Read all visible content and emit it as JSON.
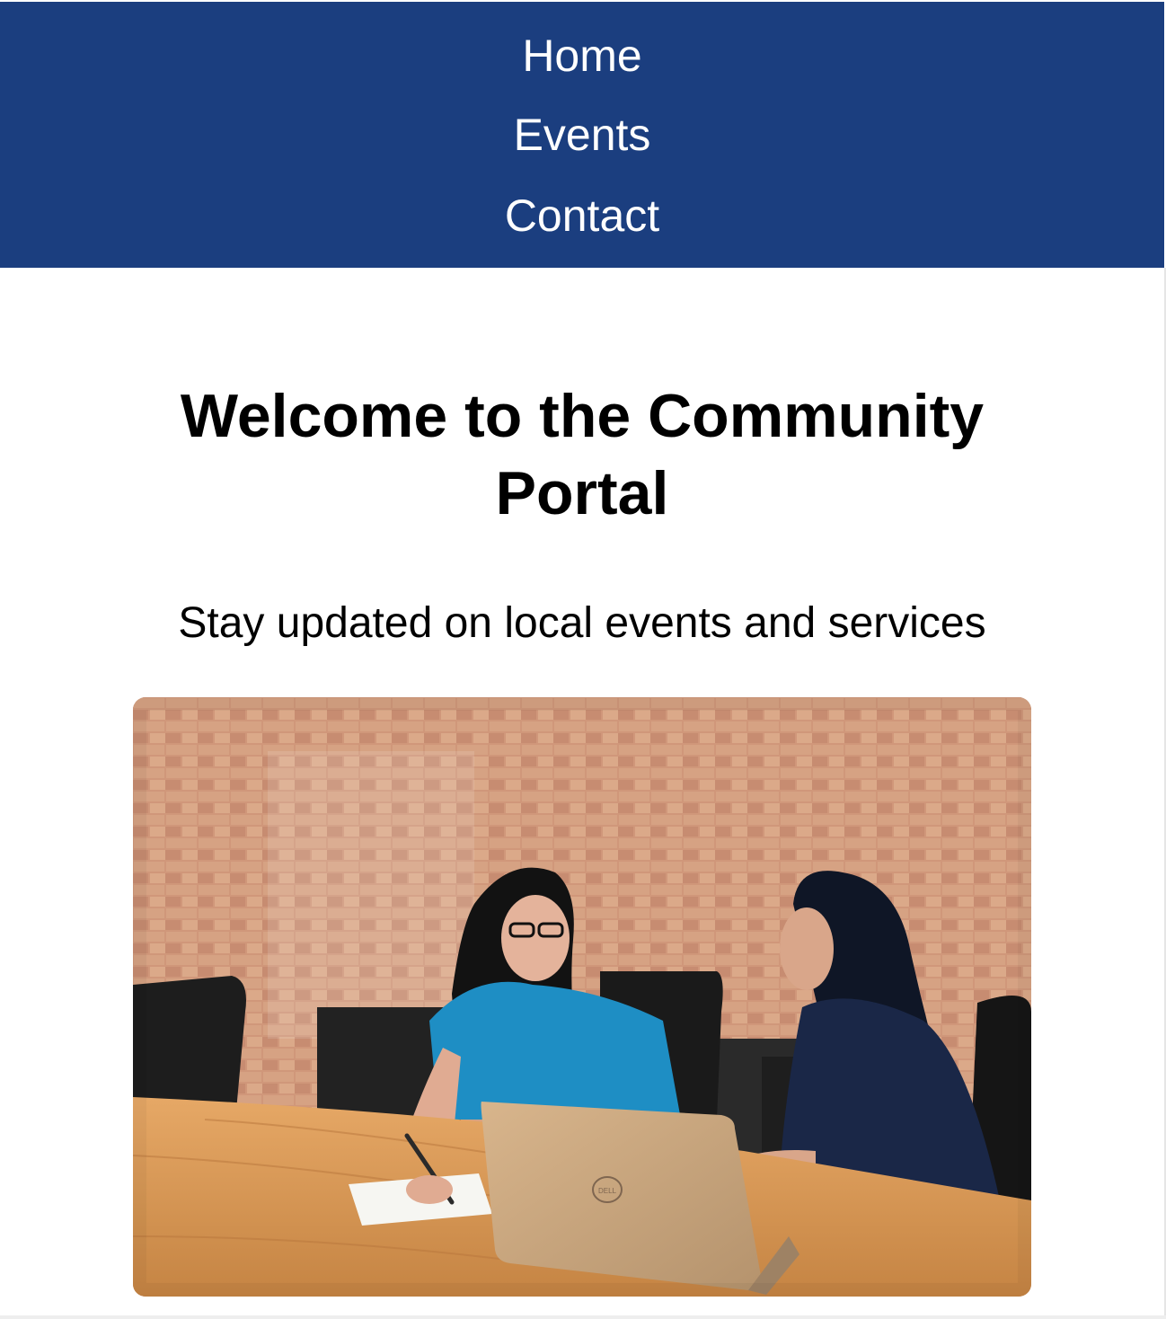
{
  "nav": {
    "items": [
      {
        "label": "Home"
      },
      {
        "label": "Events"
      },
      {
        "label": "Contact"
      }
    ],
    "background": "#1b3e7f",
    "text_color": "#ffffff"
  },
  "hero": {
    "title": "Welcome to the Community Portal",
    "subtitle": "Stay updated on local events and services"
  },
  "image": {
    "brand_mark": "DELL",
    "alt": "Two women talking at a wooden table with a laptop"
  }
}
